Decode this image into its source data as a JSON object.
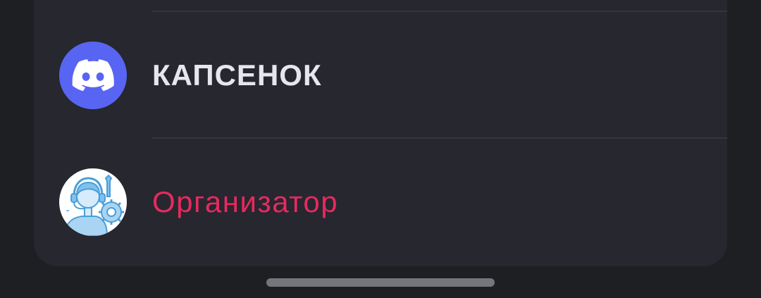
{
  "rows": [
    {
      "label": "КАПСЕНОК",
      "icon": "discord-icon",
      "icon_bg": "#5865f2",
      "label_color": "#e6e7ec"
    },
    {
      "label": "Организатор",
      "icon": "organizer-support-icon",
      "icon_bg": "#ffffff",
      "label_color": "#e8295f"
    }
  ],
  "colors": {
    "background": "#1e1f23",
    "card": "#26272f",
    "divider": "#34353d",
    "accent": "#e8295f",
    "discord": "#5865f2"
  }
}
